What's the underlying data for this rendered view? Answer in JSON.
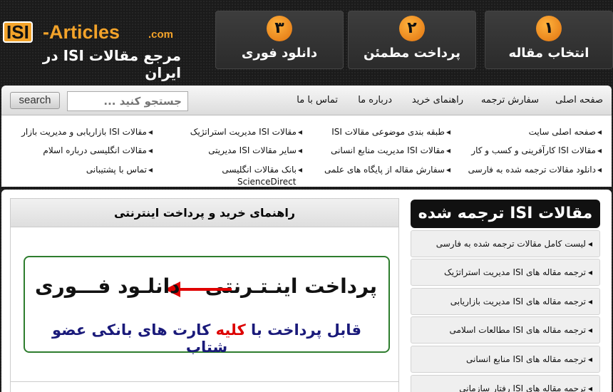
{
  "header": {
    "logo_box": "ISI",
    "logo_rest": "-Articles",
    "logo_com": ".com",
    "tagline": "مرجع مقالات ISI در ایران",
    "steps": [
      {
        "num": "١",
        "label": "انتخاب مقاله"
      },
      {
        "num": "٢",
        "label": "پرداخت مطمئن"
      },
      {
        "num": "٣",
        "label": "دانلود فوری"
      }
    ]
  },
  "nav": {
    "items": [
      "صفحه اصلی",
      "سفارش ترجمه",
      "راهنمای خرید",
      "درباره ما",
      "تماس با ما"
    ],
    "search_placeholder": "جستجو کنید ...",
    "search_button": "search"
  },
  "sublinks": {
    "col1": [
      "صفحه اصلی سایت",
      "مقالات ISI کارآفرینی و کسب و کار",
      "دانلود مقالات ترجمه شده به فارسی"
    ],
    "col2": [
      "طبقه بندی موضوعی مقالات ISI",
      "مقالات ISI مدیریت منابع انسانی",
      "سفارش مقاله از پایگاه های علمی"
    ],
    "col3": [
      "مقالات ISI مدیریت استراتژیک",
      "سایر مقالات ISI مدیریتی",
      "بانک مقالات انگلیسی"
    ],
    "col3_extra": "ScienceDirect",
    "col4": [
      "مقالات ISI بازاریابی و مدیریت بازار",
      "مقالات انگلیسی درباره اسلام",
      "تماس با پشتیبانی"
    ]
  },
  "main_panel": {
    "title": "راهنمای خرید و پرداخت اینترنتی",
    "banner_left": "دانلـود فـــوری",
    "banner_right": "پرداخت اینـتـرنتی",
    "banner_line2_a": "قابل پرداخت با ",
    "banner_line2_red": "کلیه",
    "banner_line2_b": " کارت های بانکی عضو شتاب"
  },
  "sidebar": {
    "title": "مقالات ISI ترجمه شده",
    "items": [
      "لیست کامل مقالات ترجمه شده به فارسی",
      "ترجمه مقاله های ISI مدیریت استراتژیک",
      "ترجمه مقاله های ISI مدیریت بازاریابی",
      "ترجمه مقاله های ISI مطالعات اسلامی",
      "ترجمه مقاله های ISI منابع انسانی",
      "ترجمه مقاله های ISI رفتار سازمانی"
    ]
  },
  "colors": {
    "accent": "#f3a32a",
    "banner_border": "#2e7d2e",
    "arrow": "#e00000"
  }
}
